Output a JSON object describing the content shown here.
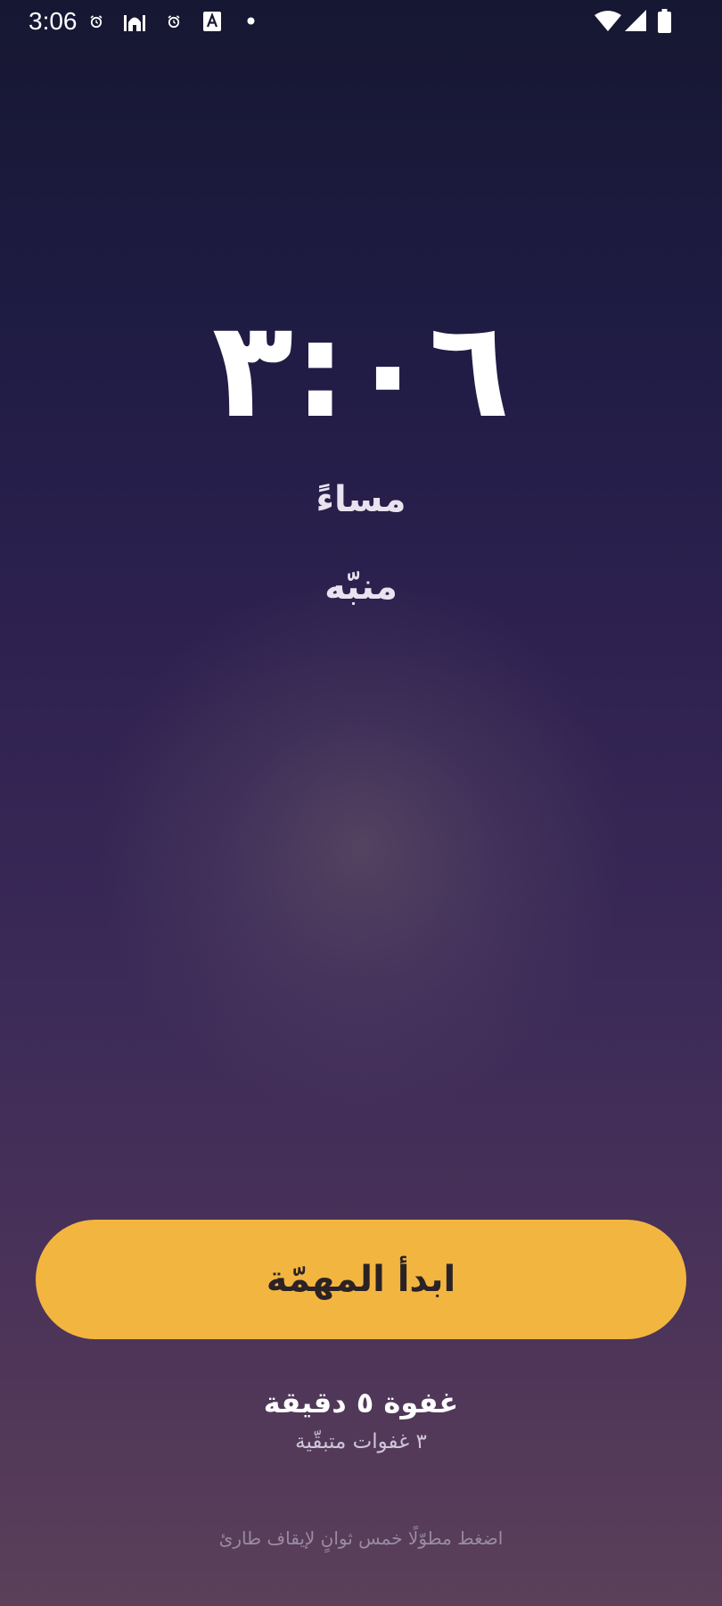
{
  "status_bar": {
    "time": "3:06",
    "icons": [
      "alarm-clock-icon",
      "mosque-icon",
      "alarm-clock-icon",
      "text-a-icon",
      "dot-icon",
      "wifi-icon",
      "cell-signal-icon",
      "battery-icon"
    ]
  },
  "alarm": {
    "time": "٣:٠٦",
    "period": "مساءً",
    "label": "منبّه"
  },
  "actions": {
    "start_task": "ابدأ المهمّة",
    "snooze": "غفوة ٥ دقيقة",
    "snoozes_remaining": "٣ غفوات متبقّية",
    "emergency_stop_hint": "اضغط مطوّلًا خمس ثوانٍ لإيقاف طارئ"
  },
  "colors": {
    "background_top": "#161732",
    "background_bottom": "#5b4059",
    "accent": "#f2b540",
    "button_text": "#2b2226"
  }
}
